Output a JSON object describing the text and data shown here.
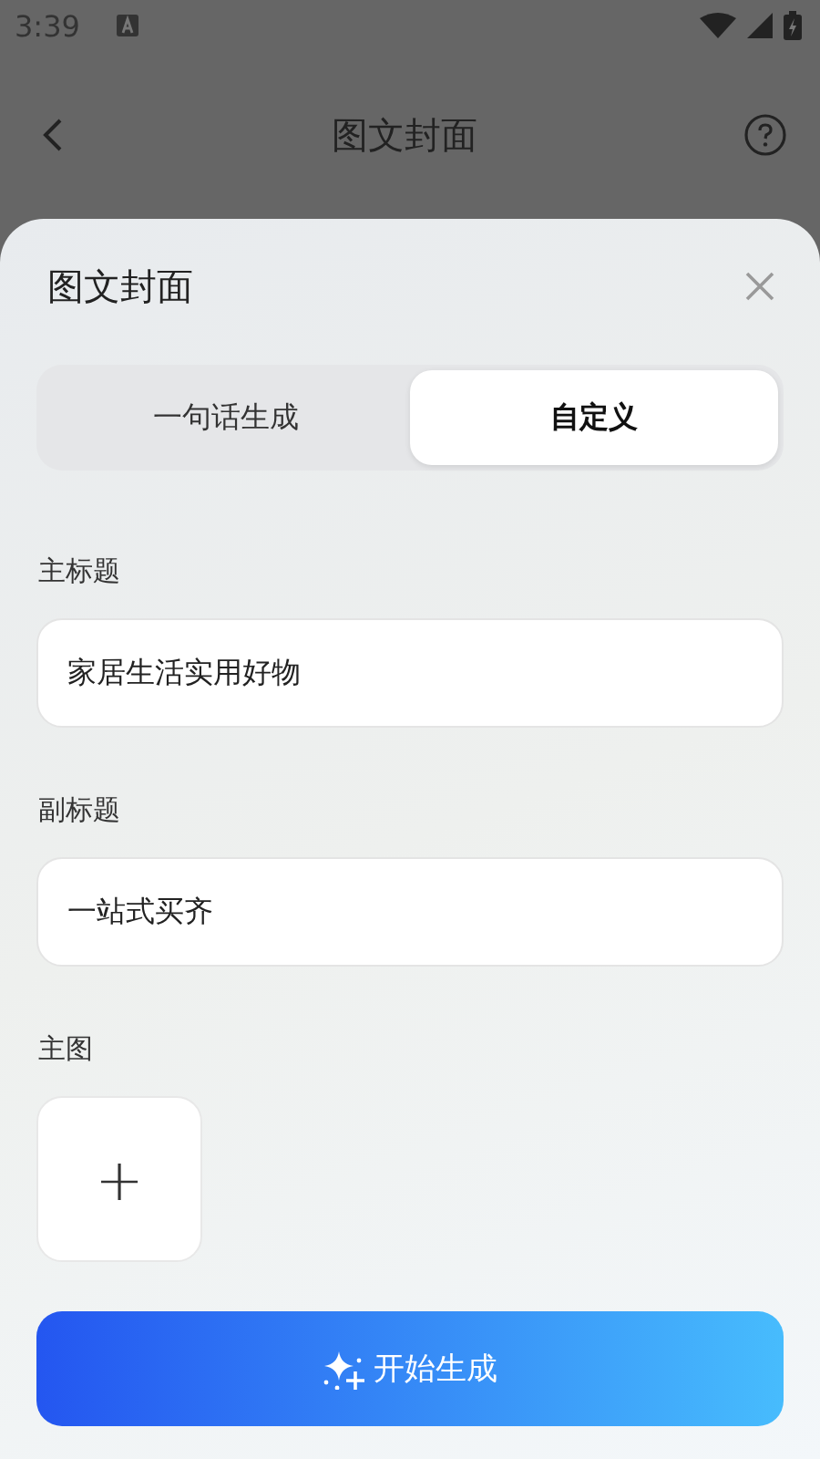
{
  "status_bar": {
    "time": "3:39"
  },
  "header": {
    "title": "图文封面"
  },
  "sheet": {
    "title": "图文封面",
    "tabs": [
      {
        "label": "一句话生成",
        "selected": false
      },
      {
        "label": "自定义",
        "selected": true
      }
    ],
    "fields": [
      {
        "label": "主标题",
        "value": "家居生活实用好物"
      },
      {
        "label": "副标题",
        "value": "一站式买齐"
      }
    ],
    "image": {
      "label": "主图",
      "symbol": "+"
    },
    "button": "开始生成"
  }
}
